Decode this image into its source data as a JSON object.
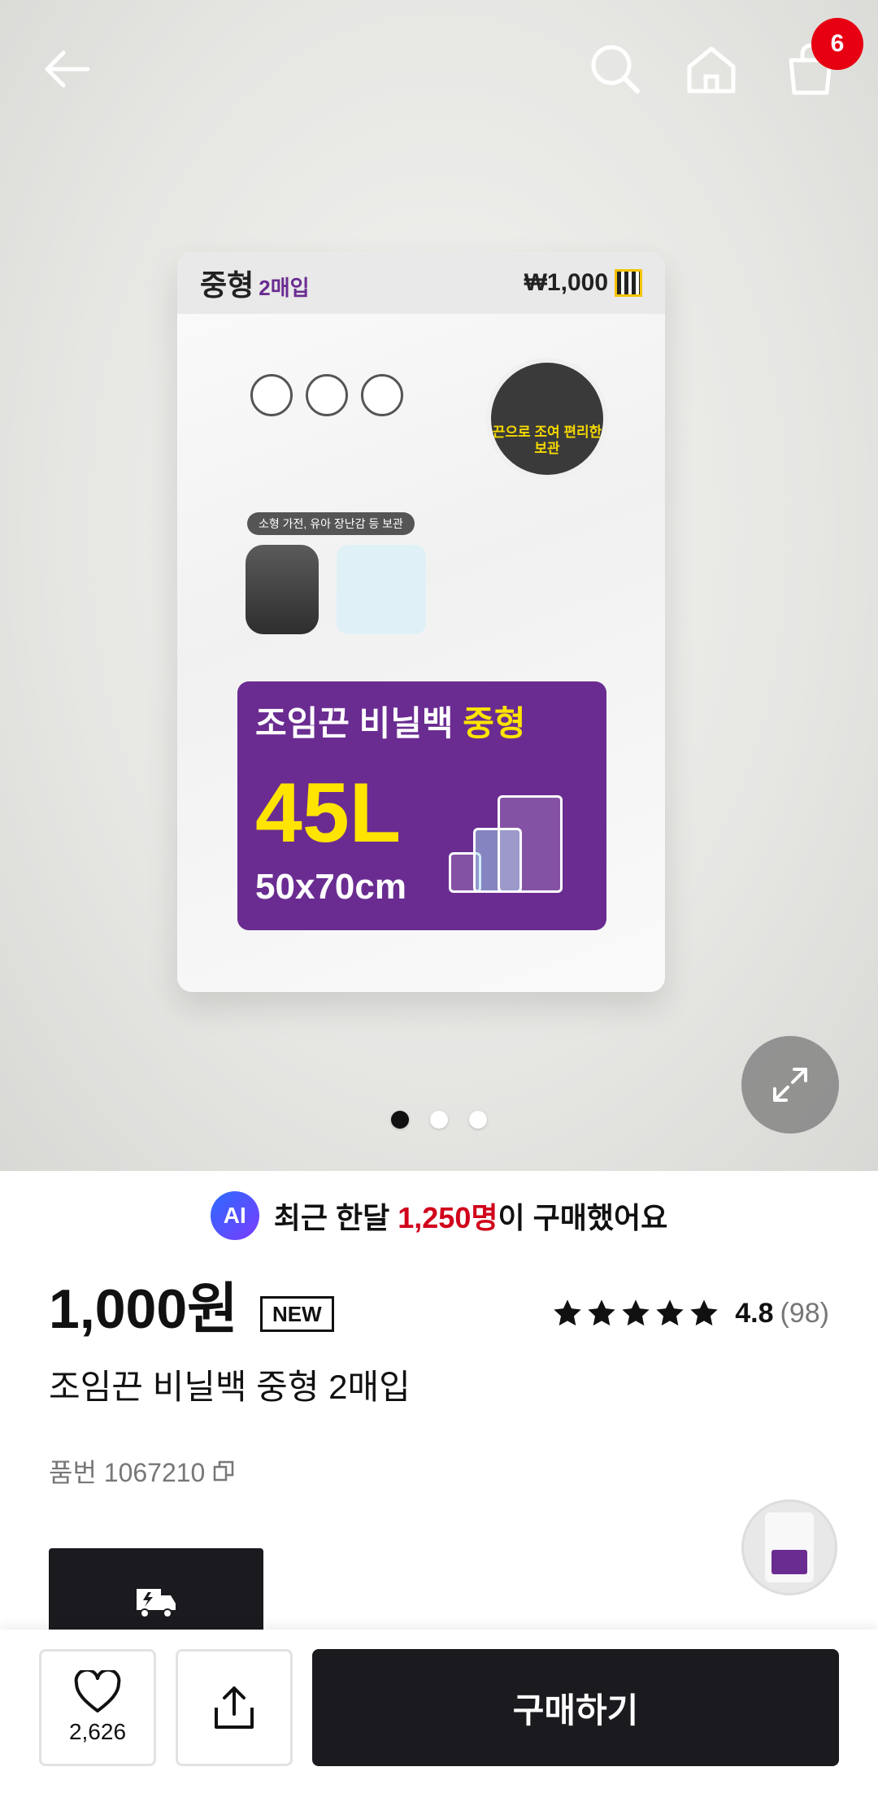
{
  "header": {
    "cart_count": "6",
    "icons": [
      "back-arrow-icon",
      "search-icon",
      "home-icon",
      "shopping-bag-icon"
    ]
  },
  "gallery": {
    "current_index": 1,
    "total": 3,
    "package": {
      "type": "중형",
      "pack": "2매입",
      "price_tag": "₩1,000",
      "circle_text": "끈으로 조여 편리한 보관",
      "tag": "소형 가전, 유아 장난감 등 보관",
      "label_line1": "조임끈 비닐백 ",
      "label_line1_highlight": "중형",
      "label_volume": "45L",
      "label_size": "50x70cm"
    }
  },
  "ai_banner": {
    "badge": "AI",
    "prefix": "최근 한달 ",
    "highlight": "1,250명",
    "suffix": "이 구매했어요"
  },
  "product": {
    "price": "1,000원",
    "badge": "NEW",
    "rating": "4.8",
    "review_count": "(98)",
    "stars": 5,
    "name": "조임끈 비닐백 중형 2매입",
    "sku": "품번 1067210"
  },
  "bottom_bar": {
    "like_count": "2,626",
    "buy_label": "구매하기"
  },
  "colors": {
    "accent_red": "#d0021b",
    "badge_red": "#e60012",
    "dark": "#1b1b1f",
    "package_purple": "#6a2c91"
  }
}
